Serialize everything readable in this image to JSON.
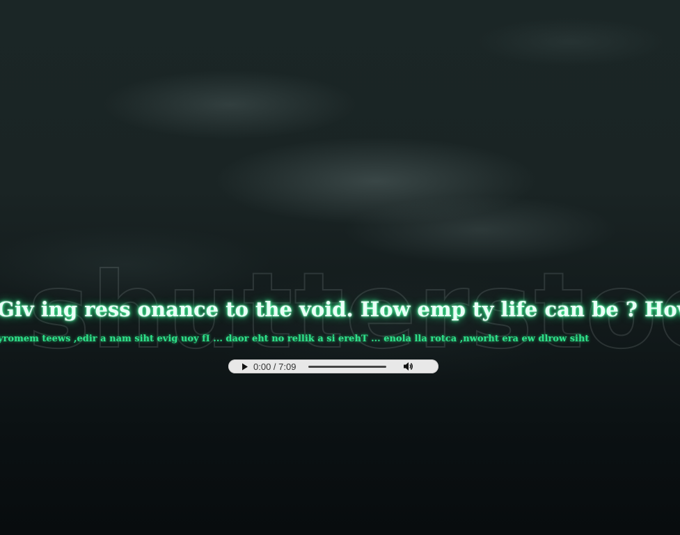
{
  "background": {
    "watermark_text": "shutterstock"
  },
  "lyrics": {
    "main_line": "Giv ing ress onance to the void. How emp ty life can be ? How",
    "reversed_line": "yromem teews ,edir a nam siht evig uoy fI ... daor eht no rellik a si erehT ... enola lla rotca ,nworht era ew dlrow siht"
  },
  "audio_player": {
    "current_time": "0:00",
    "separator": " / ",
    "duration": "7:09",
    "progress": 0,
    "play_icon": "play-icon",
    "volume_icon": "volume-icon"
  },
  "colors": {
    "glow_green": "#41ff9d",
    "reversed_text": "#2fe08a"
  }
}
